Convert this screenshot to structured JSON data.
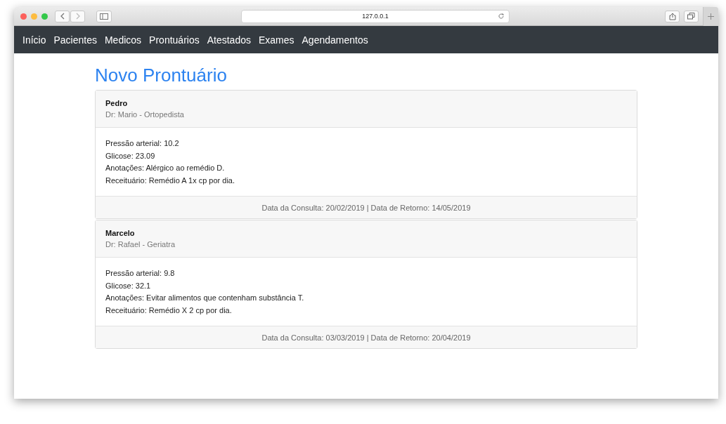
{
  "browser": {
    "address": "127.0.0.1"
  },
  "nav": [
    "Início",
    "Pacientes",
    "Medicos",
    "Prontuários",
    "Atestados",
    "Exames",
    "Agendamentos"
  ],
  "title": "Novo Prontuário",
  "records": [
    {
      "patient": "Pedro",
      "doctor": "Dr: Mario - Ortopedista",
      "lines": [
        "Pressão arterial: 10.2",
        "Glicose: 23.09",
        "Anotações: Alérgico ao remédio D.",
        "Receituário: Remédio A 1x cp por dia."
      ],
      "footer": "Data da Consulta: 20/02/2019 | Data de Retorno: 14/05/2019"
    },
    {
      "patient": "Marcelo",
      "doctor": "Dr: Rafael - Geriatra",
      "lines": [
        "Pressão arterial: 9.8",
        "Glicose: 32.1",
        "Anotações: Evitar alimentos que contenham substância T.",
        "Receituário: Remédio X 2 cp por dia."
      ],
      "footer": "Data da Consulta: 03/03/2019 | Data de Retorno: 20/04/2019"
    }
  ]
}
